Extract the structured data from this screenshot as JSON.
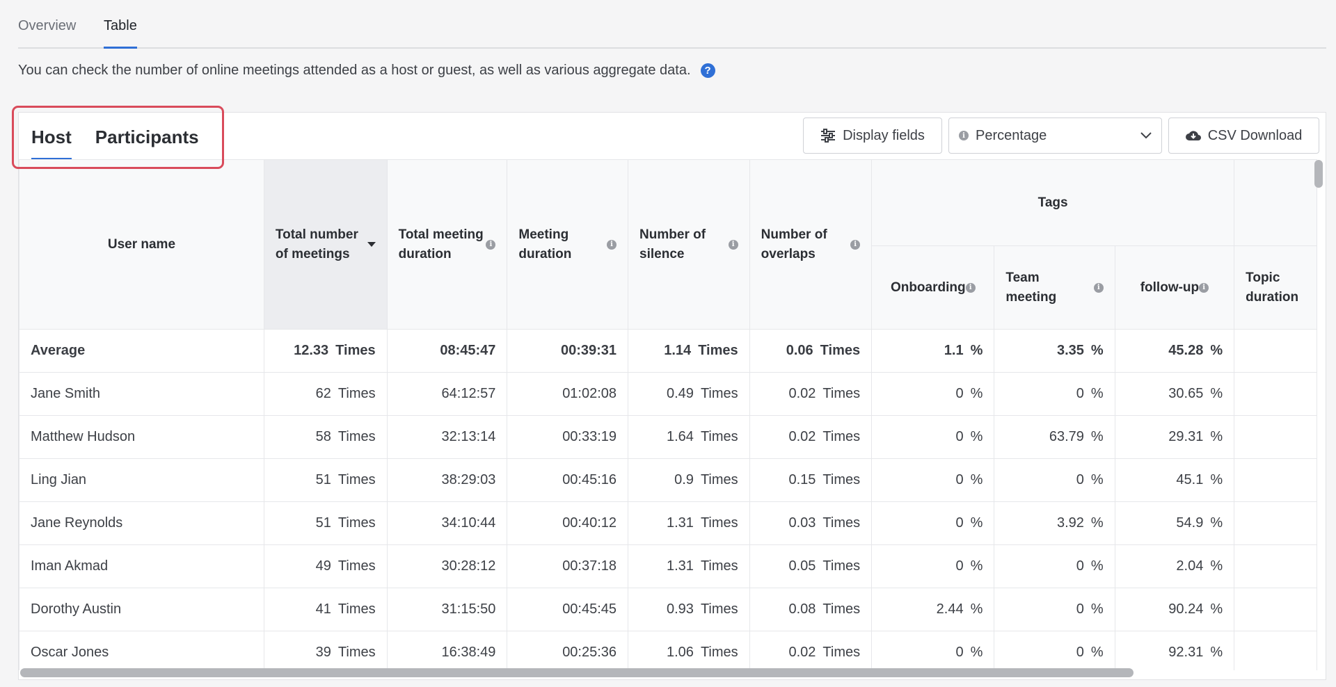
{
  "nav": {
    "tabs": [
      {
        "label": "Overview",
        "active": false
      },
      {
        "label": "Table",
        "active": true
      }
    ]
  },
  "description": "You can check the number of online meetings attended as a host or guest, as well as various aggregate data.",
  "help_icon": "?",
  "subtabs": [
    {
      "label": "Host",
      "active": true
    },
    {
      "label": "Participants",
      "active": false
    }
  ],
  "toolbar": {
    "display_fields_label": "Display fields",
    "view_select_value": "Percentage",
    "csv_download_label": "CSV Download"
  },
  "info_glyph": "i",
  "columns": {
    "user_name": "User name",
    "total_meetings": "Total number of meetings",
    "total_duration": "Total meeting duration",
    "meeting_duration": "Meeting duration",
    "silence": "Number of silence",
    "overlaps": "Number of overlaps",
    "tags_group": "Tags",
    "tag_onboarding": "Onboarding",
    "tag_team_meeting": "Team meeting",
    "tag_followup": "follow-up",
    "topic_duration": "Topic duration"
  },
  "units": {
    "times": "Times",
    "percent": "%"
  },
  "average": {
    "name": "Average",
    "meetings": "12.33",
    "total_duration": "08:45:47",
    "meeting_duration": "00:39:31",
    "silence": "1.14",
    "overlaps": "0.06",
    "onboarding": "1.1",
    "team_meeting": "3.35",
    "followup": "45.28"
  },
  "rows": [
    {
      "name": "Jane Smith",
      "meetings": "62",
      "total_duration": "64:12:57",
      "meeting_duration": "01:02:08",
      "silence": "0.49",
      "overlaps": "0.02",
      "onboarding": "0",
      "team_meeting": "0",
      "followup": "30.65"
    },
    {
      "name": "Matthew Hudson",
      "meetings": "58",
      "total_duration": "32:13:14",
      "meeting_duration": "00:33:19",
      "silence": "1.64",
      "overlaps": "0.02",
      "onboarding": "0",
      "team_meeting": "63.79",
      "followup": "29.31"
    },
    {
      "name": "Ling Jian",
      "meetings": "51",
      "total_duration": "38:29:03",
      "meeting_duration": "00:45:16",
      "silence": "0.9",
      "overlaps": "0.15",
      "onboarding": "0",
      "team_meeting": "0",
      "followup": "45.1"
    },
    {
      "name": "Jane Reynolds",
      "meetings": "51",
      "total_duration": "34:10:44",
      "meeting_duration": "00:40:12",
      "silence": "1.31",
      "overlaps": "0.03",
      "onboarding": "0",
      "team_meeting": "3.92",
      "followup": "54.9"
    },
    {
      "name": "Iman Akmad",
      "meetings": "49",
      "total_duration": "30:28:12",
      "meeting_duration": "00:37:18",
      "silence": "1.31",
      "overlaps": "0.05",
      "onboarding": "0",
      "team_meeting": "0",
      "followup": "2.04"
    },
    {
      "name": "Dorothy Austin",
      "meetings": "41",
      "total_duration": "31:15:50",
      "meeting_duration": "00:45:45",
      "silence": "0.93",
      "overlaps": "0.08",
      "onboarding": "2.44",
      "team_meeting": "0",
      "followup": "90.24"
    },
    {
      "name": "Oscar Jones",
      "meetings": "39",
      "total_duration": "16:38:49",
      "meeting_duration": "00:25:36",
      "silence": "1.06",
      "overlaps": "0.02",
      "onboarding": "0",
      "team_meeting": "0",
      "followup": "92.31"
    }
  ]
}
